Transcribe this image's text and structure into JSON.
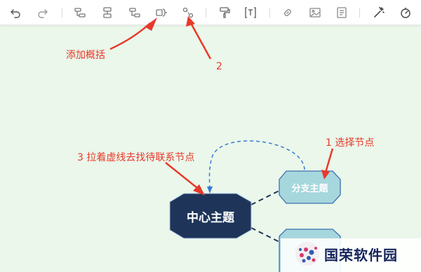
{
  "toolbar": {
    "items": [
      "undo-icon",
      "redo-icon",
      "add-sibling-topic-icon",
      "add-child-topic-icon",
      "add-parent-topic-icon",
      "add-summary-icon",
      "add-relation-icon",
      "format-painter-icon",
      "insert-text-icon",
      "insert-link-icon",
      "insert-image-icon",
      "insert-note-icon",
      "style-magic-icon",
      "theme-icon"
    ]
  },
  "annotations": {
    "add_summary": "添加概括",
    "step2": "2",
    "step3": "3 拉着虚线去找待联系节点",
    "step1": "1 选择节点"
  },
  "mindmap": {
    "center_topic": "中心主题",
    "branch_topic": "分支主题"
  },
  "watermark": {
    "text": "国荣软件园"
  },
  "colors": {
    "annotation_red": "#e8392b",
    "center_fill": "#1e3559",
    "branch_fill": "#a6d7dd",
    "relation_line": "#3a7ad6",
    "canvas_bg": "#eaf7ea"
  }
}
